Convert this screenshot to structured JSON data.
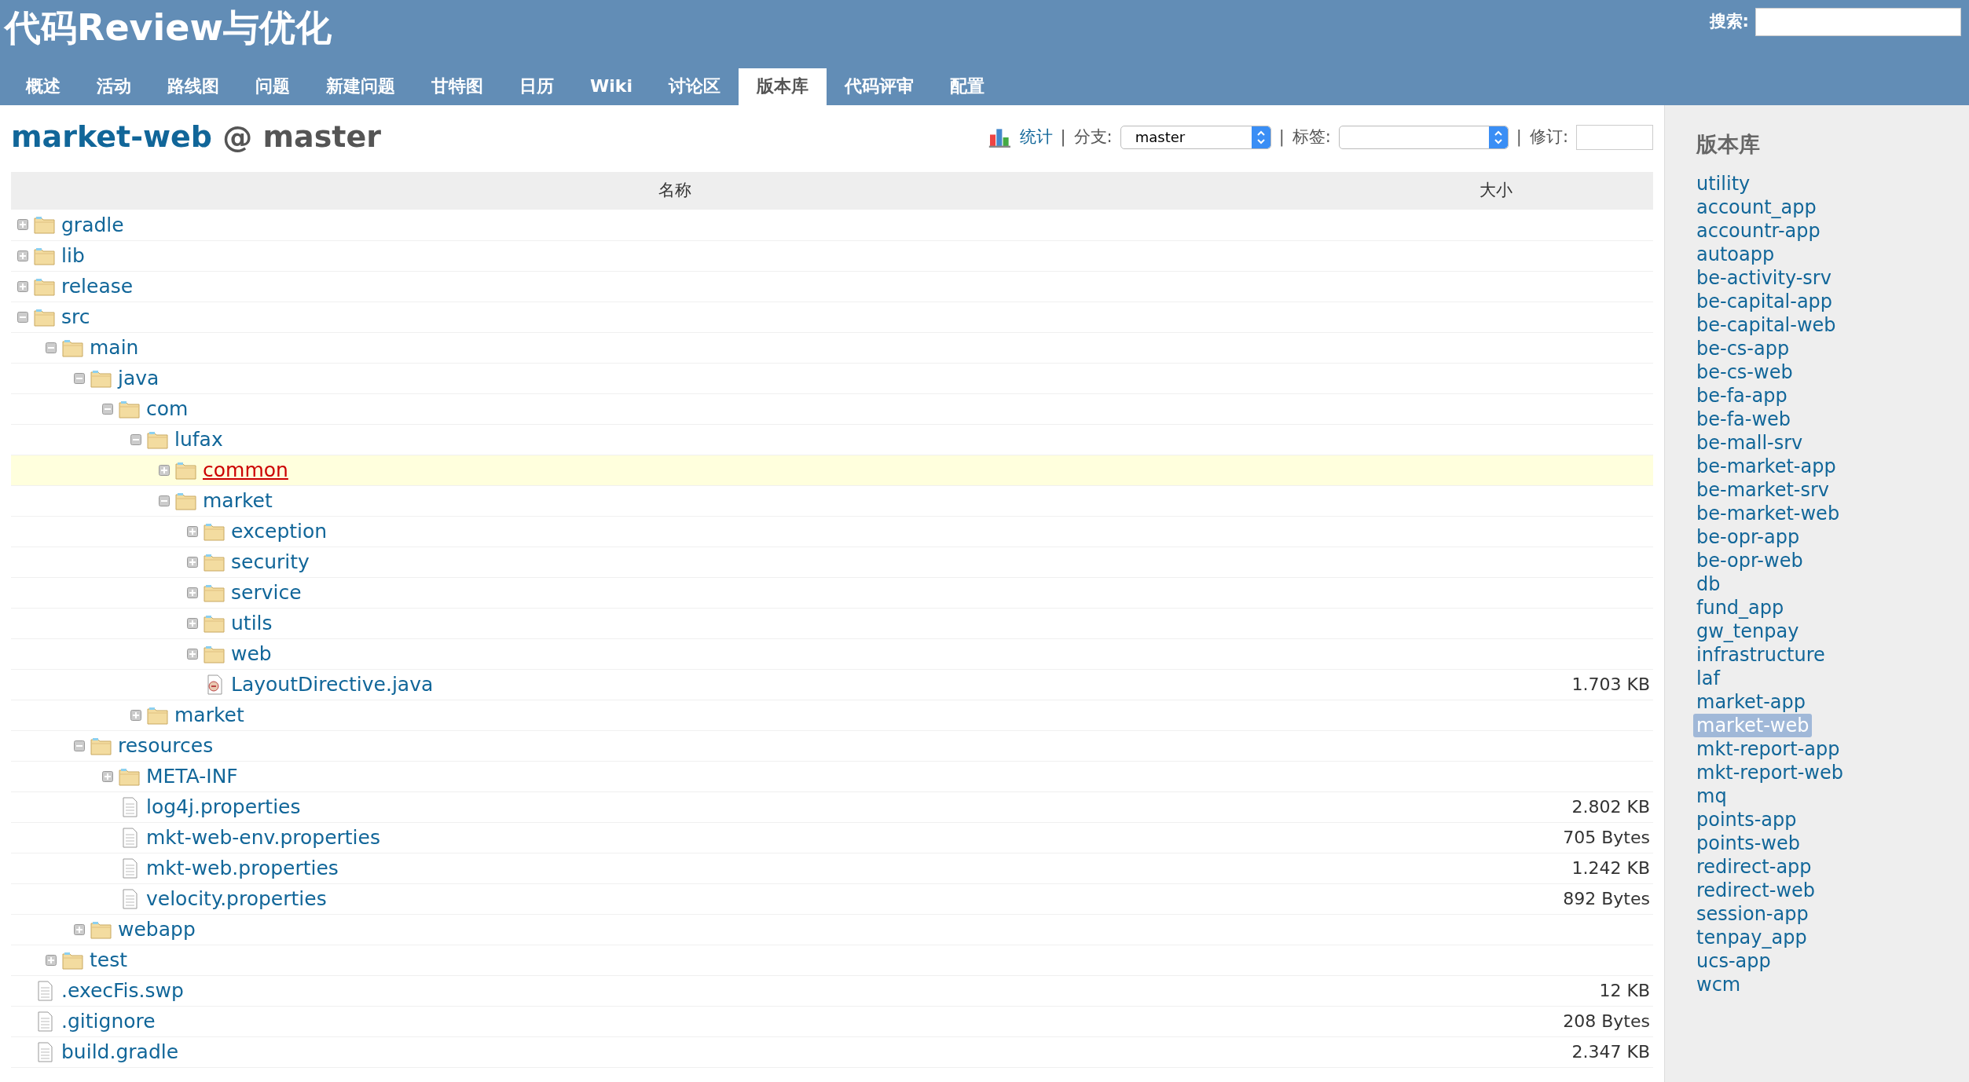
{
  "header": {
    "title": "代码Review与优化",
    "search_label": "搜索:"
  },
  "tabs": [
    {
      "label": "概述",
      "selected": false
    },
    {
      "label": "活动",
      "selected": false
    },
    {
      "label": "路线图",
      "selected": false
    },
    {
      "label": "问题",
      "selected": false
    },
    {
      "label": "新建问题",
      "selected": false
    },
    {
      "label": "甘特图",
      "selected": false
    },
    {
      "label": "日历",
      "selected": false
    },
    {
      "label": "Wiki",
      "selected": false
    },
    {
      "label": "讨论区",
      "selected": false
    },
    {
      "label": "版本库",
      "selected": true
    },
    {
      "label": "代码评审",
      "selected": false
    },
    {
      "label": "配置",
      "selected": false
    }
  ],
  "page_title": {
    "repo": "market-web",
    "rest": "@ master"
  },
  "toolbar": {
    "stats_link": "统计",
    "separators": [
      "|",
      "|",
      "|"
    ],
    "branch_label": "分支:",
    "branch_value": "master",
    "tag_label": "标签:",
    "revision_label": "修订:"
  },
  "table": {
    "columns": [
      "名称",
      "大小"
    ],
    "rows": [
      {
        "kind": "dir",
        "name": "gradle",
        "expanded": false,
        "selected": false
      },
      {
        "kind": "dir",
        "name": "lib",
        "expanded": false,
        "selected": false
      },
      {
        "kind": "dir",
        "name": "release",
        "expanded": false,
        "selected": false
      },
      {
        "kind": "dir",
        "name": "src",
        "expanded": true,
        "selected": false,
        "children": [
          {
            "kind": "dir",
            "name": "main",
            "expanded": true,
            "selected": false,
            "children": [
              {
                "kind": "dir",
                "name": "java",
                "expanded": true,
                "selected": false,
                "children": [
                  {
                    "kind": "dir",
                    "name": "com",
                    "expanded": true,
                    "selected": false,
                    "children": [
                      {
                        "kind": "dir",
                        "name": "lufax",
                        "expanded": true,
                        "selected": false,
                        "children": [
                          {
                            "kind": "dir",
                            "name": "common",
                            "expanded": false,
                            "selected": true
                          },
                          {
                            "kind": "dir",
                            "name": "market",
                            "expanded": true,
                            "selected": false,
                            "children": [
                              {
                                "kind": "dir",
                                "name": "exception",
                                "expanded": false,
                                "selected": false
                              },
                              {
                                "kind": "dir",
                                "name": "security",
                                "expanded": false,
                                "selected": false
                              },
                              {
                                "kind": "dir",
                                "name": "service",
                                "expanded": false,
                                "selected": false
                              },
                              {
                                "kind": "dir",
                                "name": "utils",
                                "expanded": false,
                                "selected": false
                              },
                              {
                                "kind": "dir",
                                "name": "web",
                                "expanded": false,
                                "selected": false
                              },
                              {
                                "kind": "java",
                                "name": "LayoutDirective.java",
                                "size": "1.703 KB",
                                "selected": false
                              }
                            ]
                          }
                        ]
                      },
                      {
                        "kind": "dir",
                        "name": "market",
                        "expanded": false,
                        "selected": false
                      }
                    ]
                  }
                ]
              },
              {
                "kind": "dir",
                "name": "resources",
                "expanded": true,
                "selected": false,
                "children": [
                  {
                    "kind": "dir",
                    "name": "META-INF",
                    "expanded": false,
                    "selected": false
                  },
                  {
                    "kind": "file",
                    "name": "log4j.properties",
                    "size": "2.802 KB",
                    "selected": false
                  },
                  {
                    "kind": "file",
                    "name": "mkt-web-env.properties",
                    "size": "705 Bytes",
                    "selected": false
                  },
                  {
                    "kind": "file",
                    "name": "mkt-web.properties",
                    "size": "1.242 KB",
                    "selected": false
                  },
                  {
                    "kind": "file",
                    "name": "velocity.properties",
                    "size": "892 Bytes",
                    "selected": false
                  }
                ]
              },
              {
                "kind": "dir",
                "name": "webapp",
                "expanded": false,
                "selected": false
              }
            ]
          },
          {
            "kind": "dir",
            "name": "test",
            "expanded": false,
            "selected": false
          }
        ]
      },
      {
        "kind": "file",
        "name": ".execFis.swp",
        "size": "12 KB",
        "selected": false
      },
      {
        "kind": "file",
        "name": ".gitignore",
        "size": "208 Bytes",
        "selected": false
      },
      {
        "kind": "file",
        "name": "build.gradle",
        "size": "2.347 KB",
        "selected": false
      }
    ]
  },
  "sidebar": {
    "title": "版本库",
    "items": [
      {
        "label": "utility",
        "selected": false
      },
      {
        "label": "account_app",
        "selected": false
      },
      {
        "label": "accountr-app",
        "selected": false
      },
      {
        "label": "autoapp",
        "selected": false
      },
      {
        "label": "be-activity-srv",
        "selected": false
      },
      {
        "label": "be-capital-app",
        "selected": false
      },
      {
        "label": "be-capital-web",
        "selected": false
      },
      {
        "label": "be-cs-app",
        "selected": false
      },
      {
        "label": "be-cs-web",
        "selected": false
      },
      {
        "label": "be-fa-app",
        "selected": false
      },
      {
        "label": "be-fa-web",
        "selected": false
      },
      {
        "label": "be-mall-srv",
        "selected": false
      },
      {
        "label": "be-market-app",
        "selected": false
      },
      {
        "label": "be-market-srv",
        "selected": false
      },
      {
        "label": "be-market-web",
        "selected": false
      },
      {
        "label": "be-opr-app",
        "selected": false
      },
      {
        "label": "be-opr-web",
        "selected": false
      },
      {
        "label": "db",
        "selected": false
      },
      {
        "label": "fund_app",
        "selected": false
      },
      {
        "label": "gw_tenpay",
        "selected": false
      },
      {
        "label": "infrastructure",
        "selected": false
      },
      {
        "label": "laf",
        "selected": false
      },
      {
        "label": "market-app",
        "selected": false
      },
      {
        "label": "market-web",
        "selected": true
      },
      {
        "label": "mkt-report-app",
        "selected": false
      },
      {
        "label": "mkt-report-web",
        "selected": false
      },
      {
        "label": "mq",
        "selected": false
      },
      {
        "label": "points-app",
        "selected": false
      },
      {
        "label": "points-web",
        "selected": false
      },
      {
        "label": "redirect-app",
        "selected": false
      },
      {
        "label": "redirect-web",
        "selected": false
      },
      {
        "label": "session-app",
        "selected": false
      },
      {
        "label": "tenpay_app",
        "selected": false
      },
      {
        "label": "ucs-app",
        "selected": false
      },
      {
        "label": "wcm",
        "selected": false
      }
    ]
  }
}
